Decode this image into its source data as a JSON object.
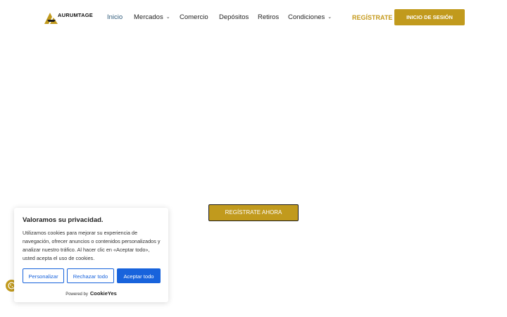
{
  "header": {
    "logo_text": "AURUMTAGE",
    "nav": [
      {
        "label": "Inicio",
        "active": true,
        "dropdown": false
      },
      {
        "label": "Mercados",
        "active": false,
        "dropdown": true
      },
      {
        "label": "Comercio",
        "active": false,
        "dropdown": false
      },
      {
        "label": "Depósitos",
        "active": false,
        "dropdown": false
      },
      {
        "label": "Retiros",
        "active": false,
        "dropdown": false
      },
      {
        "label": "Condiciones",
        "active": false,
        "dropdown": true
      }
    ],
    "register_label": "REGÍSTRATE",
    "login_label": "INICIO DE SESIÓN"
  },
  "hero": {
    "cta_label": "REGÍSTRATE AHORA"
  },
  "cookie_banner": {
    "title": "Valoramos su privacidad.",
    "text": "Utilizamos cookies para mejorar su experiencia de navegación, ofrecer anuncios o contenidos personalizados y analizar nuestro tráfico. Al hacer clic en «Aceptar todo», usted acepta el uso de cookies.",
    "customize_label": "Personalizar",
    "reject_label": "Rechazar todo",
    "accept_label": "Aceptar todo",
    "powered_by": "Powered by",
    "powered_brand": "CookieYes"
  },
  "colors": {
    "brand_gold": "#c19a1d",
    "cookie_blue": "#1863dc",
    "nav_active": "#2f5b7a"
  },
  "icons": {
    "logo": "aurumtage-logo-icon",
    "dropdown": "chevron-down-icon",
    "revisit": "cookie-icon"
  }
}
